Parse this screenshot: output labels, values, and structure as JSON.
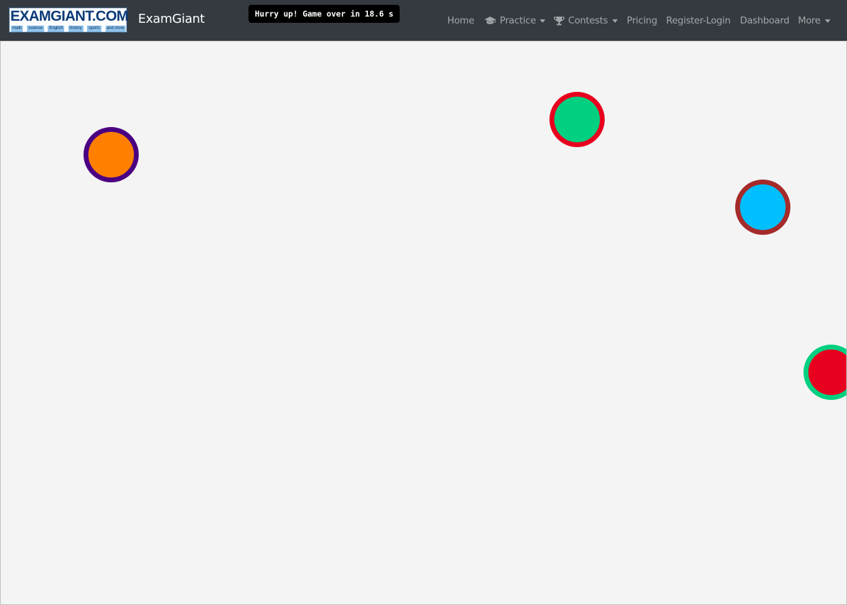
{
  "logo": {
    "text": "EXAMGIANT.COM",
    "tags": [
      "math",
      "science",
      "English",
      "history",
      "sports",
      "and more"
    ]
  },
  "brand": "ExamGiant",
  "timer": "Hurry up! Game over in 18.6 s",
  "nav": {
    "home": "Home",
    "practice": "Practice",
    "contests": "Contests",
    "pricing": "Pricing",
    "register": "Register-Login",
    "dashboard": "Dashboard",
    "more": "More"
  },
  "icons": {
    "practice": "graduation-cap-icon",
    "contests": "trophy-icon"
  },
  "balls": [
    {
      "fill": "#ff7f00",
      "ring": "#4b0082"
    },
    {
      "fill": "#00d080",
      "ring": "#e8001f"
    },
    {
      "fill": "#00bfff",
      "ring": "#a52a2a"
    },
    {
      "fill": "#e8001f",
      "ring": "#00d080"
    }
  ]
}
